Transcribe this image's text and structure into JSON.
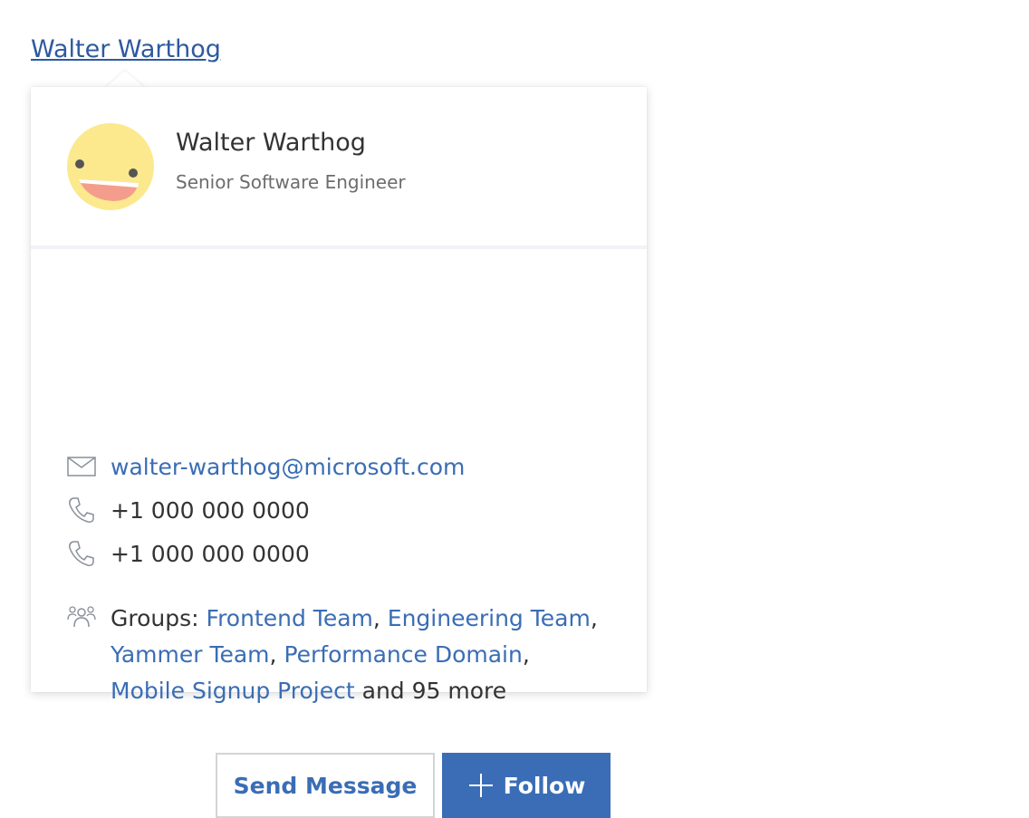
{
  "trigger": {
    "label": "Walter Warthog"
  },
  "profile": {
    "name": "Walter Warthog",
    "title": "Senior Software Engineer",
    "avatar": "smiley-avatar"
  },
  "contact": {
    "email": "walter-warthog@microsoft.com",
    "phones": [
      "+1 000 000 0000",
      "+1 000 000 0000"
    ]
  },
  "groups": {
    "prefix": "Groups: ",
    "items": [
      "Frontend Team",
      "Engineering Team",
      "Yammer Team",
      "Performance Domain",
      "Mobile Signup Project"
    ],
    "more": " and 95 more"
  },
  "actions": {
    "send_message": "Send Message",
    "follow": "Follow"
  },
  "colors": {
    "link": "#3a6db5",
    "primary_button": "#3a6db5",
    "avatar_face": "#fce98e"
  },
  "icons": [
    "mail-icon",
    "phone-icon",
    "people-icon",
    "plus-icon"
  ]
}
